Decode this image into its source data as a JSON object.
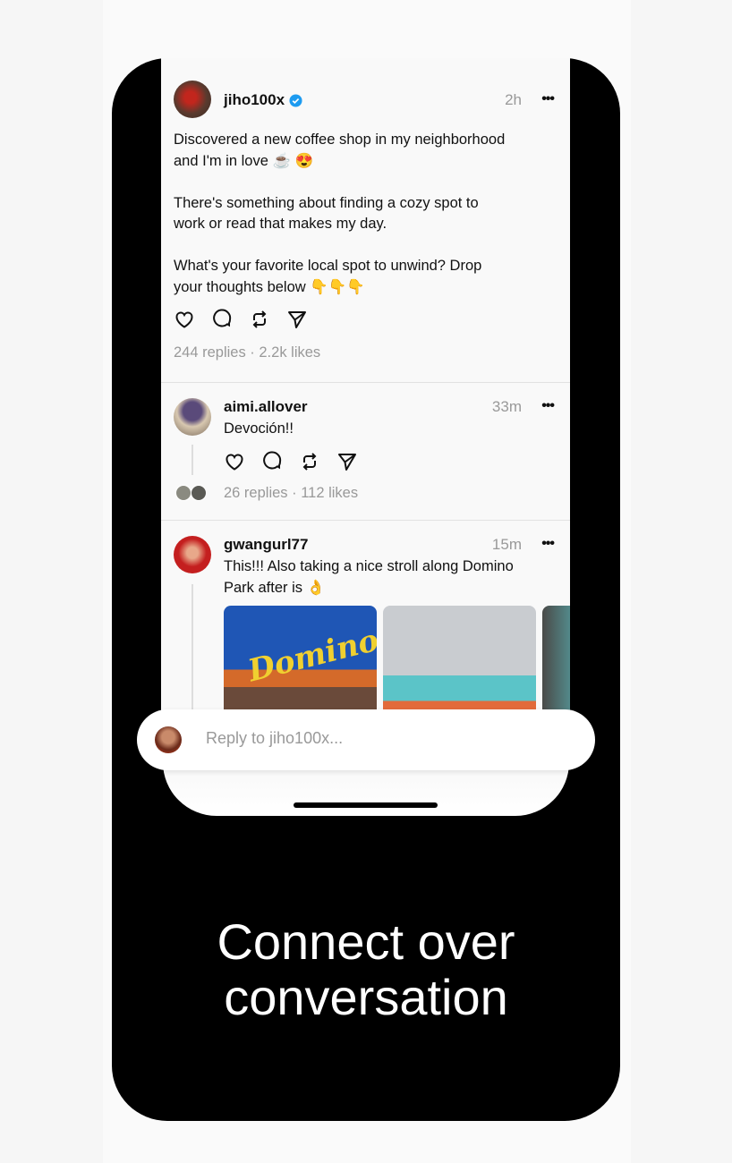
{
  "posts": [
    {
      "username": "jiho100x",
      "verified": true,
      "time": "2h",
      "text": "Discovered a new coffee shop in my neighborhood\nand I'm in love ☕ 😍\n\nThere's something about finding a cozy spot to\nwork or read that makes my day.\n\nWhat's your favorite local spot to unwind? Drop\nyour thoughts below 👇👇👇",
      "stats": "244 replies · 2.2k likes"
    },
    {
      "username": "aimi.allover",
      "time": "33m",
      "text": "Devoción!!",
      "stats": "26 replies · 112 likes"
    },
    {
      "username": "gwangurl77",
      "time": "15m",
      "text": "This!!! Also taking a nice stroll along Domino\nPark after is 👌",
      "images": [
        "Domino SUGAR sign",
        "Teal steel pier structure",
        "Teal structure"
      ]
    }
  ],
  "more_icon": "•••",
  "reply": {
    "placeholder": "Reply to jiho100x..."
  },
  "tagline": {
    "line1": "Connect over",
    "line2": "conversation"
  },
  "colors": {
    "verified": "#1d9bf0",
    "muted": "#999999",
    "phone": "#000000"
  }
}
